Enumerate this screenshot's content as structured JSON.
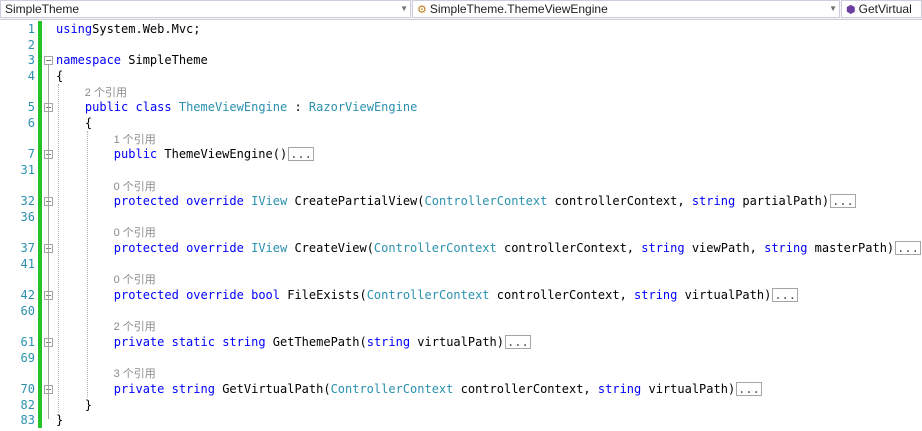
{
  "navbar": {
    "project": "SimpleTheme",
    "type": "SimpleTheme.ThemeViewEngine",
    "member": "GetVirtual"
  },
  "lines": [
    {
      "n": "1",
      "parts": [
        [
          "kw",
          "using"
        ],
        [
          "",
          "System.Web.Mvc;"
        ]
      ]
    },
    {
      "n": "2",
      "parts": []
    },
    {
      "n": "3",
      "parts": [
        [
          "kw",
          "namespace"
        ],
        [
          "",
          " SimpleTheme"
        ]
      ]
    },
    {
      "n": "4",
      "parts": [
        [
          "",
          "{"
        ]
      ]
    },
    {
      "lens": "2 个引用"
    },
    {
      "n": "5",
      "parts": [
        [
          "",
          "    "
        ],
        [
          "kw",
          "public"
        ],
        [
          "",
          " "
        ],
        [
          "kw",
          "class"
        ],
        [
          "",
          " "
        ],
        [
          "ty",
          "ThemeViewEngine"
        ],
        [
          "",
          " : "
        ],
        [
          "ty",
          "RazorViewEngine"
        ]
      ]
    },
    {
      "n": "6",
      "parts": [
        [
          "",
          "    {"
        ]
      ]
    },
    {
      "lens": "1 个引用"
    },
    {
      "n": "7",
      "parts": [
        [
          "",
          "        "
        ],
        [
          "kw",
          "public"
        ],
        [
          "",
          " ThemeViewEngine()"
        ]
      ],
      "collapsed": "..."
    },
    {
      "n": "31",
      "parts": []
    },
    {
      "lens": "0 个引用"
    },
    {
      "n": "32",
      "parts": [
        [
          "",
          "        "
        ],
        [
          "kw",
          "protected"
        ],
        [
          "",
          " "
        ],
        [
          "kw",
          "override"
        ],
        [
          "",
          " "
        ],
        [
          "ty",
          "IView"
        ],
        [
          "",
          " CreatePartialView("
        ],
        [
          "ty",
          "ControllerContext"
        ],
        [
          "",
          " controllerContext, "
        ],
        [
          "kw",
          "string"
        ],
        [
          "",
          " partialPath)"
        ]
      ],
      "collapsed": "..."
    },
    {
      "n": "36",
      "parts": []
    },
    {
      "lens": "0 个引用"
    },
    {
      "n": "37",
      "parts": [
        [
          "",
          "        "
        ],
        [
          "kw",
          "protected"
        ],
        [
          "",
          " "
        ],
        [
          "kw",
          "override"
        ],
        [
          "",
          " "
        ],
        [
          "ty",
          "IView"
        ],
        [
          "",
          " CreateView("
        ],
        [
          "ty",
          "ControllerContext"
        ],
        [
          "",
          " controllerContext, "
        ],
        [
          "kw",
          "string"
        ],
        [
          "",
          " viewPath, "
        ],
        [
          "kw",
          "string"
        ],
        [
          "",
          " masterPath)"
        ]
      ],
      "collapsed": "..."
    },
    {
      "n": "41",
      "parts": []
    },
    {
      "lens": "0 个引用"
    },
    {
      "n": "42",
      "parts": [
        [
          "",
          "        "
        ],
        [
          "kw",
          "protected"
        ],
        [
          "",
          " "
        ],
        [
          "kw",
          "override"
        ],
        [
          "",
          " "
        ],
        [
          "kw",
          "bool"
        ],
        [
          "",
          " FileExists("
        ],
        [
          "ty",
          "ControllerContext"
        ],
        [
          "",
          " controllerContext, "
        ],
        [
          "kw",
          "string"
        ],
        [
          "",
          " virtualPath)"
        ]
      ],
      "collapsed": "..."
    },
    {
      "n": "60",
      "parts": []
    },
    {
      "lens": "2 个引用"
    },
    {
      "n": "61",
      "parts": [
        [
          "",
          "        "
        ],
        [
          "kw",
          "private"
        ],
        [
          "",
          " "
        ],
        [
          "kw",
          "static"
        ],
        [
          "",
          " "
        ],
        [
          "kw",
          "string"
        ],
        [
          "",
          " GetThemePath("
        ],
        [
          "kw",
          "string"
        ],
        [
          "",
          " virtualPath)"
        ]
      ],
      "collapsed": "..."
    },
    {
      "n": "69",
      "parts": []
    },
    {
      "lens": "3 个引用"
    },
    {
      "n": "70",
      "parts": [
        [
          "",
          "        "
        ],
        [
          "kw",
          "private"
        ],
        [
          "",
          " "
        ],
        [
          "kw",
          "string"
        ],
        [
          "",
          " GetVirtualPath("
        ],
        [
          "ty",
          "ControllerContext"
        ],
        [
          "",
          " controllerContext, "
        ],
        [
          "kw",
          "string"
        ],
        [
          "",
          " virtualPath)"
        ]
      ],
      "collapsed": "..."
    },
    {
      "n": "82",
      "parts": [
        [
          "",
          "    }"
        ]
      ]
    },
    {
      "n": "83",
      "parts": [
        [
          "",
          "}"
        ]
      ]
    }
  ]
}
